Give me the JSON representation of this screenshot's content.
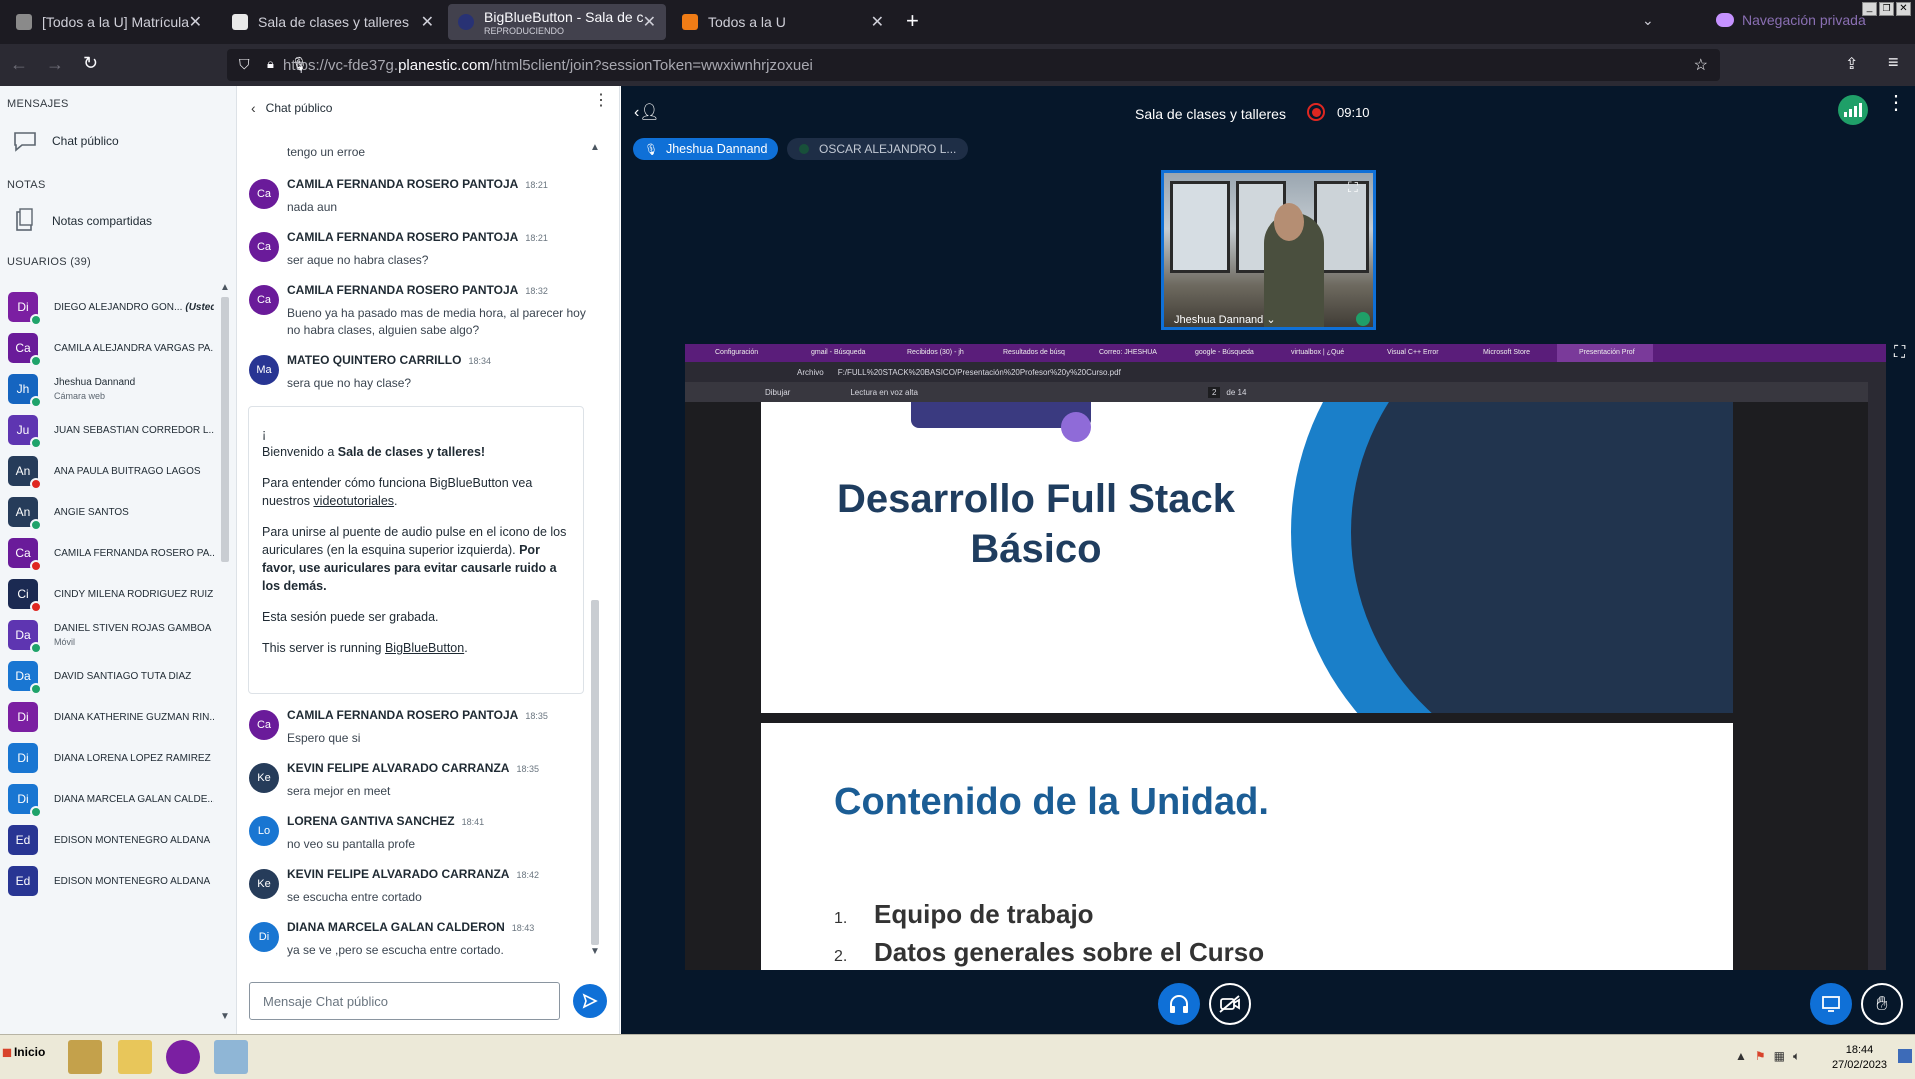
{
  "browser": {
    "tabs": [
      {
        "title": "[Todos a la U] Matrícula e in",
        "active": false,
        "icon_color": "#8a8a8a"
      },
      {
        "title": "Sala de clases y talleres",
        "active": false,
        "icon_color": "#e9e9e9"
      },
      {
        "title": "BigBlueButton - Sala de clase",
        "subtitle": "REPRODUCIENDO",
        "active": true,
        "icon_color": "#283274"
      },
      {
        "title": "Todos a la U",
        "active": false,
        "icon_color": "#ef7c16"
      }
    ],
    "private_label": "Navegación privada",
    "url_prefix": "https://vc-fde37g.",
    "url_domain": "planestic.com",
    "url_suffix": "/html5client/join?sessionToken=wwxiwnhrjzoxuei"
  },
  "sidebar": {
    "messages_heading": "MENSAJES",
    "public_chat": "Chat público",
    "notes_heading": "NOTAS",
    "shared_notes": "Notas compartidas",
    "users_heading": "USUARIOS (39)",
    "users": [
      {
        "initials": "Di",
        "name": "DIEGO ALEJANDRO GON...",
        "tag": "(Usted)",
        "color": "#7b1fa2",
        "status": "green"
      },
      {
        "initials": "Ca",
        "name": "CAMILA ALEJANDRA VARGAS PA...",
        "color": "#6a1b9a",
        "status": "green"
      },
      {
        "initials": "Jh",
        "name": "Jheshua Dannand",
        "sub": "Cámara web",
        "color": "#1565c0",
        "status": "green"
      },
      {
        "initials": "Ju",
        "name": "JUAN SEBASTIAN CORREDOR L...",
        "color": "#5e35b1",
        "status": "green"
      },
      {
        "initials": "An",
        "name": "ANA PAULA BUITRAGO LAGOS",
        "color": "#263c5a",
        "status": "red"
      },
      {
        "initials": "An",
        "name": "ANGIE SANTOS",
        "color": "#263c5a",
        "status": "green"
      },
      {
        "initials": "Ca",
        "name": "CAMILA FERNANDA ROSERO PA...",
        "color": "#6a1b9a",
        "status": "red"
      },
      {
        "initials": "Ci",
        "name": "CINDY MILENA RODRIGUEZ RUIZ",
        "color": "#1b2a52",
        "status": "red"
      },
      {
        "initials": "Da",
        "name": "DANIEL STIVEN ROJAS GAMBOA",
        "sub": "Móvil",
        "color": "#5e35b1",
        "status": "green"
      },
      {
        "initials": "Da",
        "name": "DAVID SANTIAGO TUTA DIAZ",
        "color": "#1976d2",
        "status": "green"
      },
      {
        "initials": "Di",
        "name": "DIANA KATHERINE GUZMAN RIN...",
        "color": "#7b1fa2",
        "status": "none"
      },
      {
        "initials": "Di",
        "name": "DIANA LORENA LOPEZ RAMIREZ",
        "color": "#1976d2",
        "status": "none"
      },
      {
        "initials": "Di",
        "name": "DIANA MARCELA GALAN CALDE...",
        "color": "#1976d2",
        "status": "green"
      },
      {
        "initials": "Ed",
        "name": "EDISON MONTENEGRO ALDANA",
        "color": "#283593",
        "status": "none"
      },
      {
        "initials": "Ed",
        "name": "EDISON MONTENEGRO ALDANA",
        "color": "#283593",
        "status": "none"
      }
    ]
  },
  "chat": {
    "title": "Chat público",
    "partial_text": "tengo un erroe",
    "messages_top": [
      {
        "initials": "Ca",
        "color": "#6a1b9a",
        "name": "CAMILA FERNANDA ROSERO PANTOJA",
        "time": "18:21",
        "text": "nada aun"
      },
      {
        "initials": "Ca",
        "color": "#6a1b9a",
        "name": "CAMILA FERNANDA ROSERO PANTOJA",
        "time": "18:21",
        "text": "ser aque no habra clases?"
      },
      {
        "initials": "Ca",
        "color": "#6a1b9a",
        "name": "CAMILA FERNANDA ROSERO PANTOJA",
        "time": "18:32",
        "text": "Bueno ya ha pasado mas de media hora, al parecer hoy no habra clases, alguien sabe algo?"
      },
      {
        "initials": "Ma",
        "color": "#283593",
        "name": "MATEO QUINTERO CARRILLO",
        "time": "18:34",
        "text": "sera que no hay clase?"
      }
    ],
    "welcome": {
      "exclaim": "¡",
      "line1_pre": "Bienvenido a ",
      "line1_bold": "Sala de clases y talleres!",
      "p2_pre": "Para entender cómo funciona BigBlueButton vea nuestros ",
      "p2_link": "videotutoriales",
      "p2_post": ".",
      "p3_pre": "Para unirse al puente de audio pulse en el icono de los auriculares (en la esquina superior izquierda). ",
      "p3_bold": "Por favor, use auriculares para evitar causarle ruido a los demás.",
      "p4": "Esta sesión puede ser grabada.",
      "p5_pre": "This server is running ",
      "p5_link": "BigBlueButton",
      "p5_post": "."
    },
    "messages_bottom": [
      {
        "initials": "Ca",
        "color": "#6a1b9a",
        "name": "CAMILA FERNANDA ROSERO PANTOJA",
        "time": "18:35",
        "text": "Espero que si"
      },
      {
        "initials": "Ke",
        "color": "#263c5a",
        "name": "KEVIN FELIPE ALVARADO CARRANZA",
        "time": "18:35",
        "text": "sera mejor en meet"
      },
      {
        "initials": "Lo",
        "color": "#1976d2",
        "name": "LORENA GANTIVA SANCHEZ",
        "time": "18:41",
        "text": "no veo su pantalla profe"
      },
      {
        "initials": "Ke",
        "color": "#263c5a",
        "name": "KEVIN FELIPE ALVARADO CARRANZA",
        "time": "18:42",
        "text": "se escucha entre cortado"
      },
      {
        "initials": "Di",
        "color": "#1976d2",
        "name": "DIANA MARCELA GALAN CALDERON",
        "time": "18:43",
        "text": "ya se ve ,pero se escucha entre cortado."
      }
    ],
    "input_placeholder": "Mensaje Chat público"
  },
  "meeting": {
    "title": "Sala de clases y talleres",
    "record_time": "09:10",
    "talkers": [
      "Jheshua Dannand",
      "OSCAR ALEJANDRO L..."
    ],
    "webcam_name": "Jheshua Dannand"
  },
  "screenshare": {
    "inner_tabs": [
      "Configuración",
      "gmail - Búsqueda",
      "Recibidos (30) - jh",
      "Resultados de búsq",
      "Correo: JHESHUA",
      "google - Búsqueda",
      "virtualbox | ¿Qué",
      "Visual C++ Error",
      "Microsoft Store",
      "Presentación Prof"
    ],
    "file_label": "Archivo",
    "file_path": "F:/FULL%20STACK%20BASICO/Presentación%20Profesor%20y%20Curso.pdf",
    "draw_label": "Dibujar",
    "read_label": "Lectura en voz alta",
    "page_current": "2",
    "page_total": "de 14",
    "slide1_title_line1": "Desarrollo Full Stack",
    "slide1_title_line2": "Básico",
    "slide2_title": "Contenido de la Unidad.",
    "slide2_items": [
      {
        "num": "1.",
        "text": "Equipo de trabajo"
      },
      {
        "num": "2.",
        "text": "Datos generales sobre el Curso"
      }
    ]
  },
  "taskbar": {
    "start_label": "Inicio",
    "clock_time": "18:44",
    "clock_date": "27/02/2023"
  }
}
